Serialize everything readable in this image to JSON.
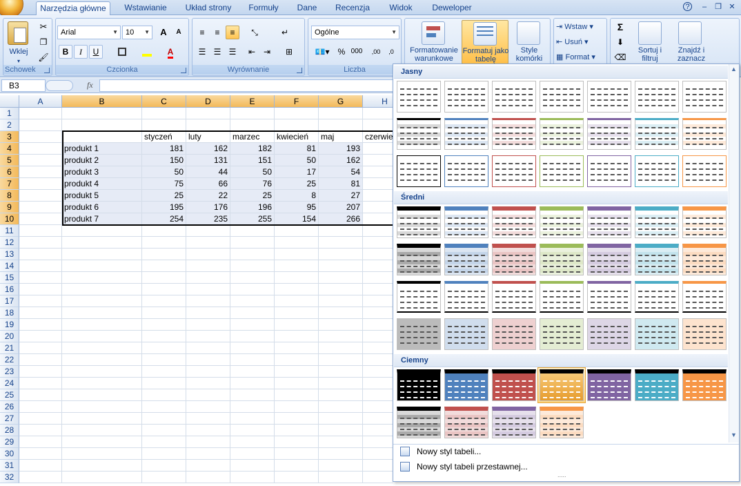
{
  "tabs": [
    {
      "label": "Narzędzia główne",
      "active": true
    },
    {
      "label": "Wstawianie"
    },
    {
      "label": "Układ strony"
    },
    {
      "label": "Formuły"
    },
    {
      "label": "Dane"
    },
    {
      "label": "Recenzja"
    },
    {
      "label": "Widok"
    },
    {
      "label": "Deweloper"
    }
  ],
  "window": {
    "help": "?",
    "minimize": "–",
    "restore": "❐",
    "close": "✕"
  },
  "ribbon": {
    "clipboard": {
      "paste": "Wklej",
      "label": "Schowek"
    },
    "font": {
      "name": "Arial",
      "size": "10",
      "grow": "A",
      "shrink": "A",
      "bold": "B",
      "italic": "I",
      "underline": "U",
      "fontcolor": "A",
      "label": "Czcionka"
    },
    "alignment": {
      "label": "Wyrównanie"
    },
    "number": {
      "format": "Ogólne",
      "percent": "%",
      "thousands": "000",
      "inc": ",00",
      "dec": ",0",
      "label": "Liczba"
    },
    "styles": {
      "conditional": "Formatowanie warunkowe",
      "table": "Formatuj jako tabelę",
      "cell": "Style komórki"
    },
    "cells": {
      "insert": "Wstaw",
      "delete": "Usuń",
      "format": "Format"
    },
    "editing": {
      "sigma": "Σ",
      "sort": "Sortuj i filtruj",
      "find": "Znajdź i zaznacz"
    }
  },
  "formula": {
    "namebox": "B3",
    "fx": "fx",
    "value": ""
  },
  "columns": [
    "A",
    "B",
    "C",
    "D",
    "E",
    "F",
    "G",
    "H"
  ],
  "rows": [
    "1",
    "2",
    "3",
    "4",
    "5",
    "6",
    "7",
    "8",
    "9",
    "10",
    "11",
    "12",
    "13",
    "14",
    "15",
    "16",
    "17",
    "18",
    "19",
    "20",
    "21",
    "22",
    "23",
    "24",
    "25",
    "26",
    "27",
    "28",
    "29",
    "30",
    "31",
    "32"
  ],
  "table": {
    "headers": [
      "styczeń",
      "luty",
      "marzec",
      "kwiecień",
      "maj",
      "czerwie"
    ],
    "rows": [
      {
        "label": "produkt 1",
        "values": [
          "181",
          "162",
          "182",
          "81",
          "193"
        ]
      },
      {
        "label": "produkt 2",
        "values": [
          "150",
          "131",
          "151",
          "50",
          "162"
        ]
      },
      {
        "label": "produkt 3",
        "values": [
          "50",
          "44",
          "50",
          "17",
          "54"
        ]
      },
      {
        "label": "produkt 4",
        "values": [
          "75",
          "66",
          "76",
          "25",
          "81"
        ]
      },
      {
        "label": "produkt 5",
        "values": [
          "25",
          "22",
          "25",
          "8",
          "27"
        ]
      },
      {
        "label": "produkt 6",
        "values": [
          "195",
          "176",
          "196",
          "95",
          "207"
        ]
      },
      {
        "label": "produkt 7",
        "values": [
          "254",
          "235",
          "255",
          "154",
          "266"
        ]
      }
    ]
  },
  "gallery": {
    "sections": [
      "Jasny",
      "Średni",
      "Ciemny"
    ],
    "colors": [
      "#000000",
      "#4f81bd",
      "#c0504d",
      "#9bbb59",
      "#8064a2",
      "#4bacc6",
      "#f79646"
    ],
    "menu": [
      "Nowy styl tabeli...",
      "Nowy styl tabeli przestawnej..."
    ],
    "grip": "....."
  }
}
